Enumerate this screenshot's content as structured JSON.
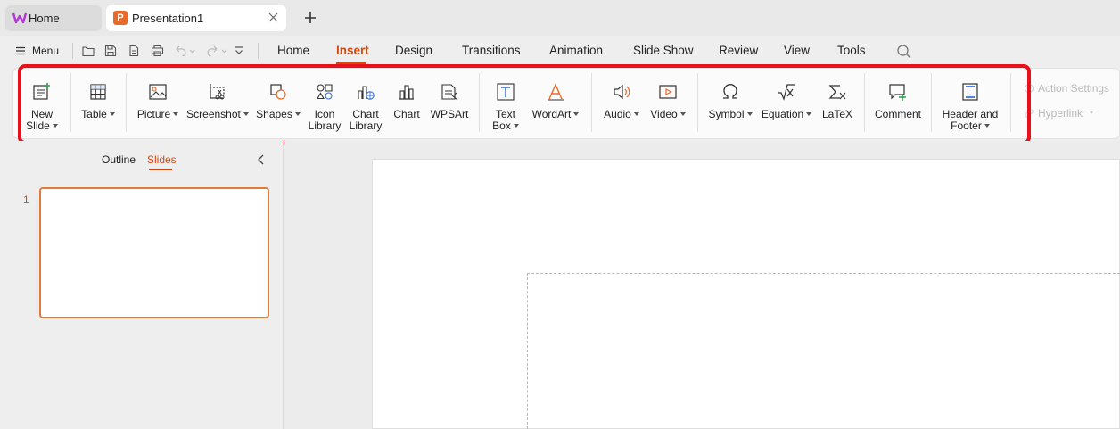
{
  "tabs": {
    "home_label": "Home",
    "doc_label": "Presentation1"
  },
  "menubar": {
    "menu_label": "Menu",
    "tabs": [
      "Home",
      "Insert",
      "Design",
      "Transitions",
      "Animation",
      "Slide Show",
      "Review",
      "View",
      "Tools"
    ],
    "active_tab": "Insert"
  },
  "ribbon": {
    "new_slide": [
      "New",
      "Slide"
    ],
    "table": "Table",
    "picture": "Picture",
    "screenshot": "Screenshot",
    "shapes": "Shapes",
    "icon_library": [
      "Icon",
      "Library"
    ],
    "chart_library": [
      "Chart",
      "Library"
    ],
    "chart": "Chart",
    "wpsart": "WPSArt",
    "text_box": [
      "Text",
      "Box"
    ],
    "wordart": "WordArt",
    "audio": "Audio",
    "video": "Video",
    "symbol": "Symbol",
    "equation": "Equation",
    "latex": "LaTeX",
    "comment": "Comment",
    "header_footer": [
      "Header and",
      "Footer"
    ],
    "action_settings": "Action Settings",
    "hyperlink": "Hyperlink"
  },
  "left_panel": {
    "outline_label": "Outline",
    "slides_label": "Slides",
    "slide_number": "1"
  },
  "colors": {
    "accent": "#d24a12",
    "highlight": "#e8101b",
    "icon_blue": "#3a6fd8"
  }
}
